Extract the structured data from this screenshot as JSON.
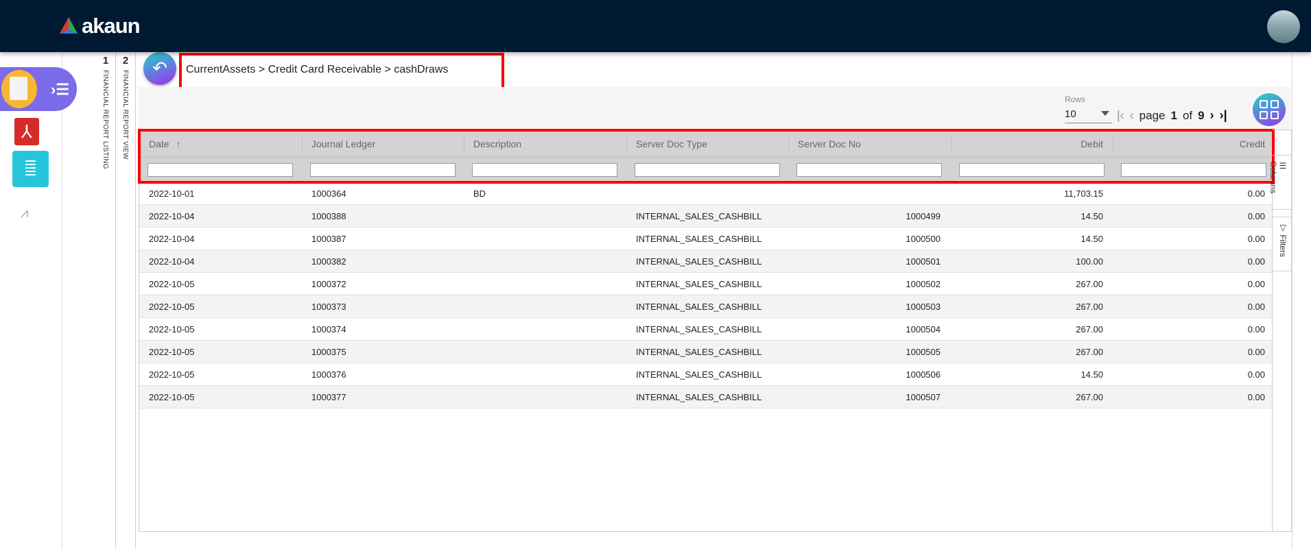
{
  "app": {
    "name": "akaun"
  },
  "tabs": [
    {
      "num": "1",
      "label": "FINANCIAL REPORT LISTING"
    },
    {
      "num": "2",
      "label": "FINANCIAL REPORT VIEW"
    }
  ],
  "breadcrumb": "CurrentAssets > Credit Card Receivable > cashDraws",
  "pagination": {
    "rows_label": "Rows",
    "rows_value": "10",
    "page_label": "page",
    "current": "1",
    "of_label": "of",
    "total": "9"
  },
  "side_panel": {
    "columns": "Columns",
    "filters": "Filters"
  },
  "colors": {
    "topbar": "#001a33",
    "accent": "#7b6be8",
    "highlight": "#ff0000"
  },
  "table": {
    "columns": [
      "Date",
      "Journal Ledger",
      "Description",
      "Server Doc Type",
      "Server Doc No",
      "Debit",
      "Credit"
    ],
    "sort_indicator": "↑",
    "rows": [
      [
        "2022-10-01",
        "1000364",
        "BD",
        "",
        "",
        "11,703.15",
        "0.00"
      ],
      [
        "2022-10-04",
        "1000388",
        "",
        "INTERNAL_SALES_CASHBILL",
        "1000499",
        "14.50",
        "0.00"
      ],
      [
        "2022-10-04",
        "1000387",
        "",
        "INTERNAL_SALES_CASHBILL",
        "1000500",
        "14.50",
        "0.00"
      ],
      [
        "2022-10-04",
        "1000382",
        "",
        "INTERNAL_SALES_CASHBILL",
        "1000501",
        "100.00",
        "0.00"
      ],
      [
        "2022-10-05",
        "1000372",
        "",
        "INTERNAL_SALES_CASHBILL",
        "1000502",
        "267.00",
        "0.00"
      ],
      [
        "2022-10-05",
        "1000373",
        "",
        "INTERNAL_SALES_CASHBILL",
        "1000503",
        "267.00",
        "0.00"
      ],
      [
        "2022-10-05",
        "1000374",
        "",
        "INTERNAL_SALES_CASHBILL",
        "1000504",
        "267.00",
        "0.00"
      ],
      [
        "2022-10-05",
        "1000375",
        "",
        "INTERNAL_SALES_CASHBILL",
        "1000505",
        "267.00",
        "0.00"
      ],
      [
        "2022-10-05",
        "1000376",
        "",
        "INTERNAL_SALES_CASHBILL",
        "1000506",
        "14.50",
        "0.00"
      ],
      [
        "2022-10-05",
        "1000377",
        "",
        "INTERNAL_SALES_CASHBILL",
        "1000507",
        "267.00",
        "0.00"
      ]
    ]
  }
}
